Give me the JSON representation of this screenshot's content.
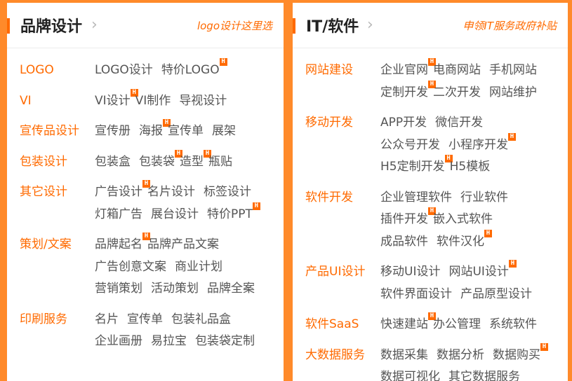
{
  "panels": [
    {
      "title": "品牌设计",
      "chevron": "›",
      "link": "logo设计这里选",
      "rows": [
        {
          "cat": "LOGO",
          "lines": [
            [
              {
                "t": "LOGO设计"
              },
              {
                "t": "特价LOGO",
                "hot": true
              }
            ]
          ]
        },
        {
          "cat": "VI",
          "lines": [
            [
              {
                "t": "VI设计",
                "hot": true
              },
              {
                "t": "VI制作"
              },
              {
                "t": "导视设计"
              }
            ]
          ]
        },
        {
          "cat": "宣传品设计",
          "lines": [
            [
              {
                "t": "宣传册"
              },
              {
                "t": "海报",
                "hot": true
              },
              {
                "t": "宣传单"
              },
              {
                "t": "展架"
              }
            ]
          ]
        },
        {
          "cat": "包装设计",
          "lines": [
            [
              {
                "t": "包装盒"
              },
              {
                "t": "包装袋",
                "hot": true
              },
              {
                "t": "造型",
                "hot": true
              },
              {
                "t": "瓶贴"
              }
            ]
          ]
        },
        {
          "cat": "其它设计",
          "lines": [
            [
              {
                "t": "广告设计",
                "hot": true
              },
              {
                "t": "名片设计"
              },
              {
                "t": "标签设计"
              }
            ],
            [
              {
                "t": "灯箱广告"
              },
              {
                "t": "展台设计"
              },
              {
                "t": "特价PPT",
                "hot": true
              }
            ]
          ]
        },
        {
          "cat": "策划/文案",
          "lines": [
            [
              {
                "t": "品牌起名",
                "hot": true
              },
              {
                "t": "品牌产品文案"
              }
            ],
            [
              {
                "t": "广告创意文案"
              },
              {
                "t": "商业计划"
              }
            ],
            [
              {
                "t": "营销策划"
              },
              {
                "t": "活动策划"
              },
              {
                "t": "品牌全案"
              }
            ]
          ]
        },
        {
          "cat": "印刷服务",
          "lines": [
            [
              {
                "t": "名片"
              },
              {
                "t": "宣传单"
              },
              {
                "t": "包装礼品盒"
              }
            ],
            [
              {
                "t": "企业画册"
              },
              {
                "t": "易拉宝"
              },
              {
                "t": "包装袋定制"
              }
            ]
          ]
        }
      ]
    },
    {
      "title": "IT/软件",
      "chevron": "›",
      "link": "申领IT服务政府补贴",
      "rows": [
        {
          "cat": "网站建设",
          "lines": [
            [
              {
                "t": "企业官网",
                "hot": true
              },
              {
                "t": "电商网站"
              },
              {
                "t": "手机网站"
              }
            ],
            [
              {
                "t": "定制开发",
                "hot": true
              },
              {
                "t": "二次开发"
              },
              {
                "t": "网站维护"
              }
            ]
          ]
        },
        {
          "cat": "移动开发",
          "lines": [
            [
              {
                "t": "APP开发"
              },
              {
                "t": "微信开发"
              }
            ],
            [
              {
                "t": "公众号开发"
              },
              {
                "t": "小程序开发",
                "hot": true
              }
            ],
            [
              {
                "t": "H5定制开发",
                "hot": true
              },
              {
                "t": "H5模板"
              }
            ]
          ]
        },
        {
          "cat": "软件开发",
          "lines": [
            [
              {
                "t": "企业管理软件"
              },
              {
                "t": "行业软件"
              }
            ],
            [
              {
                "t": "插件开发",
                "hot": true
              },
              {
                "t": "嵌入式软件"
              }
            ],
            [
              {
                "t": "成品软件"
              },
              {
                "t": "软件汉化",
                "hot": true
              }
            ]
          ]
        },
        {
          "cat": "产品UI设计",
          "lines": [
            [
              {
                "t": "移动UI设计"
              },
              {
                "t": "网站UI设计",
                "hot": true
              }
            ],
            [
              {
                "t": "软件界面设计"
              },
              {
                "t": "产品原型设计"
              }
            ]
          ]
        },
        {
          "cat": "软件SaaS",
          "lines": [
            [
              {
                "t": "快速建站",
                "hot": true
              },
              {
                "t": "办公管理"
              },
              {
                "t": "系统软件"
              }
            ]
          ]
        },
        {
          "cat": "大数据服务",
          "lines": [
            [
              {
                "t": "数据采集"
              },
              {
                "t": "数据分析"
              },
              {
                "t": "数据购买",
                "hot": true
              }
            ],
            [
              {
                "t": "数据可视化"
              },
              {
                "t": "其它数据服务"
              }
            ]
          ]
        }
      ]
    }
  ],
  "badge_label": "H",
  "colors": {
    "accent": "#ff6a00",
    "background": "#ff8a2a",
    "text": "#555555"
  }
}
